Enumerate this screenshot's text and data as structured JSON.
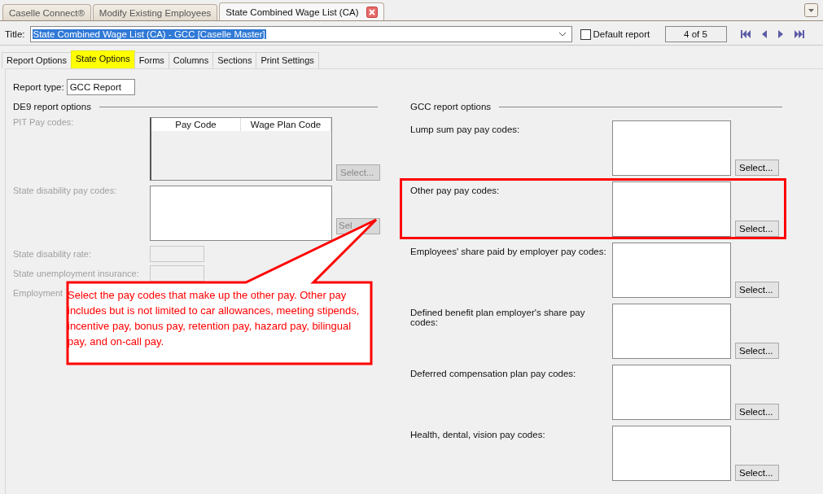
{
  "top_tabs": [
    {
      "label": "Caselle Connect®",
      "selected": false,
      "closable": false
    },
    {
      "label": "Modify Existing Employees",
      "selected": false,
      "closable": false
    },
    {
      "label": "State Combined Wage List (CA)",
      "selected": true,
      "closable": true
    }
  ],
  "title_bar": {
    "label": "Title:",
    "value": "State Combined Wage List (CA) - GCC [Caselle Master]",
    "default_report": {
      "label": "Default report",
      "checked": false
    },
    "record": "4 of 5"
  },
  "tabs": [
    {
      "label": "Report Options",
      "selected": false
    },
    {
      "label": "State Options",
      "selected": true
    },
    {
      "label": "Forms",
      "selected": false
    },
    {
      "label": "Columns",
      "selected": false
    },
    {
      "label": "Sections",
      "selected": false
    },
    {
      "label": "Print Settings",
      "selected": false
    }
  ],
  "report_type": {
    "label": "Report type:",
    "value": "GCC Report"
  },
  "de9": {
    "heading": "DE9 report options",
    "disabled": true,
    "pit": {
      "label": "PIT Pay codes:",
      "columns": [
        "Pay Code",
        "Wage Plan Code"
      ],
      "button": "Select..."
    },
    "sdi": {
      "label": "State disability pay codes:",
      "button": "Sel"
    },
    "fields": [
      {
        "label": "State disability rate:"
      },
      {
        "label": "State unemployment insurance:"
      },
      {
        "label": "Employment"
      }
    ]
  },
  "gcc": {
    "heading": "GCC report options",
    "rows": [
      {
        "label": "Lump sum pay pay codes:",
        "button": "Select...",
        "highlighted": false
      },
      {
        "label": "Other pay pay codes:",
        "button": "Select...",
        "highlighted": true
      },
      {
        "label": "Employees' share paid by employer pay codes:",
        "button": "Select...",
        "highlighted": false
      },
      {
        "label": "Defined benefit plan employer's share pay codes:",
        "button": "Select...",
        "highlighted": false
      },
      {
        "label": "Deferred compensation plan pay codes:",
        "button": "Select...",
        "highlighted": false
      },
      {
        "label": "Health, dental, vision pay codes:",
        "button": "Select...",
        "highlighted": false
      }
    ]
  },
  "callout": {
    "text": "Select the pay codes that make up the other pay. Other pay includes but is not limited to car allowances, meeting stipends, incentive pay, bonus pay, retention pay, hazard pay, bilingual pay, and on-call pay."
  }
}
